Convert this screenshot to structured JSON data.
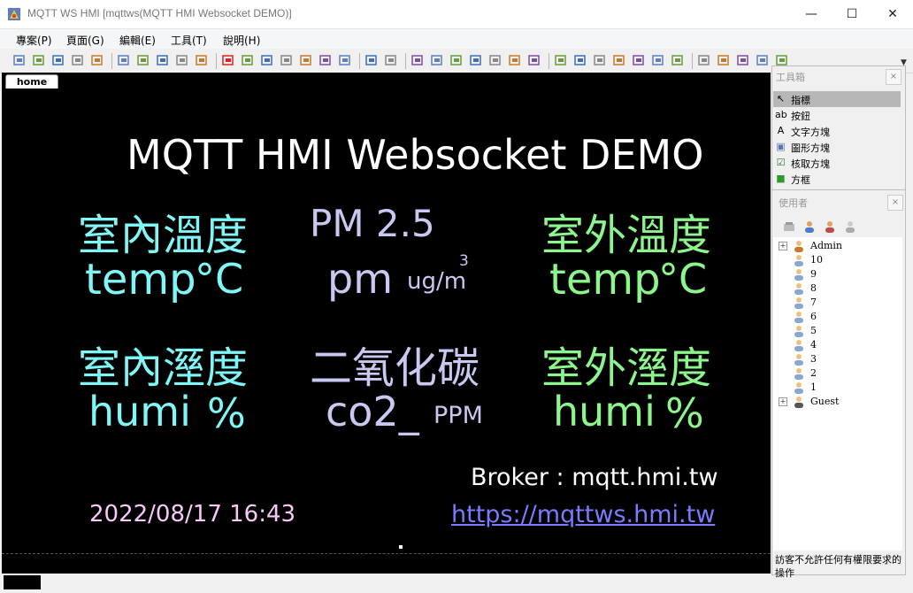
{
  "window": {
    "title": "MQTT WS HMI [mqttws(MQTT HMI Websocket DEMO)]",
    "minimize": "—",
    "maximize": "☐",
    "close": "✕"
  },
  "menu": [
    "專案(P)",
    "頁面(G)",
    "編輯(E)",
    "工具(T)",
    "說明(H)"
  ],
  "tabs": [
    {
      "label": "home"
    }
  ],
  "hmi": {
    "title": "MQTT HMI Websocket DEMO",
    "indoor_temp_label": "室內溫度",
    "indoor_temp_value": "temp",
    "indoor_temp_unit": "°C",
    "pm_label": "PM 2.5",
    "pm_value": "pm",
    "pm_unit": "ug/m",
    "pm_unit_sup": "3",
    "outdoor_temp_label": "室外溫度",
    "outdoor_temp_value": "temp",
    "outdoor_temp_unit": "°C",
    "indoor_humi_label": "室內溼度",
    "indoor_humi_value": "humi",
    "indoor_humi_unit": "%",
    "co2_label": "二氧化碳",
    "co2_value": "co2_",
    "co2_unit": "PPM",
    "outdoor_humi_label": "室外溼度",
    "outdoor_humi_value": "humi",
    "outdoor_humi_unit": "%",
    "broker": "Broker : mqtt.hmi.tw",
    "datetime": "2022/08/17 16:43",
    "link": "https://mqttws.hmi.tw"
  },
  "colors": {
    "indoor": "#7ff7f7",
    "pm": "#c8c8f0",
    "outdoor": "#8cf58c",
    "datetime": "#f8c8f8",
    "link": "#7b7bff"
  },
  "toolbox": {
    "title": "工具箱",
    "close": "×",
    "items": [
      {
        "label": "指標",
        "icon": "pointer-icon",
        "glyph": "↖",
        "selected": true
      },
      {
        "label": "按鈕",
        "icon": "button-icon",
        "glyph": "ab"
      },
      {
        "label": "文字方塊",
        "icon": "text-icon",
        "glyph": "A"
      },
      {
        "label": "圖形方塊",
        "icon": "image-icon",
        "glyph": "▣"
      },
      {
        "label": "核取方塊",
        "icon": "checkbox-icon",
        "glyph": "☑"
      },
      {
        "label": "方框",
        "icon": "rectangle-icon",
        "glyph": "■"
      }
    ]
  },
  "users": {
    "title": "使用者",
    "close": "×",
    "tree": [
      {
        "label": "Admin",
        "expander": "+",
        "icon": "user-group-icon"
      },
      {
        "label": "10",
        "icon": "user-icon"
      },
      {
        "label": "9",
        "icon": "user-icon"
      },
      {
        "label": "8",
        "icon": "user-icon"
      },
      {
        "label": "7",
        "icon": "user-icon"
      },
      {
        "label": "6",
        "icon": "user-icon"
      },
      {
        "label": "5",
        "icon": "user-icon"
      },
      {
        "label": "4",
        "icon": "user-icon"
      },
      {
        "label": "3",
        "icon": "user-icon"
      },
      {
        "label": "2",
        "icon": "user-icon"
      },
      {
        "label": "1",
        "icon": "user-icon"
      },
      {
        "label": "Guest",
        "expander": "+",
        "icon": "guest-icon"
      }
    ],
    "note": "訪客不允許任何有權限要求的操作"
  }
}
